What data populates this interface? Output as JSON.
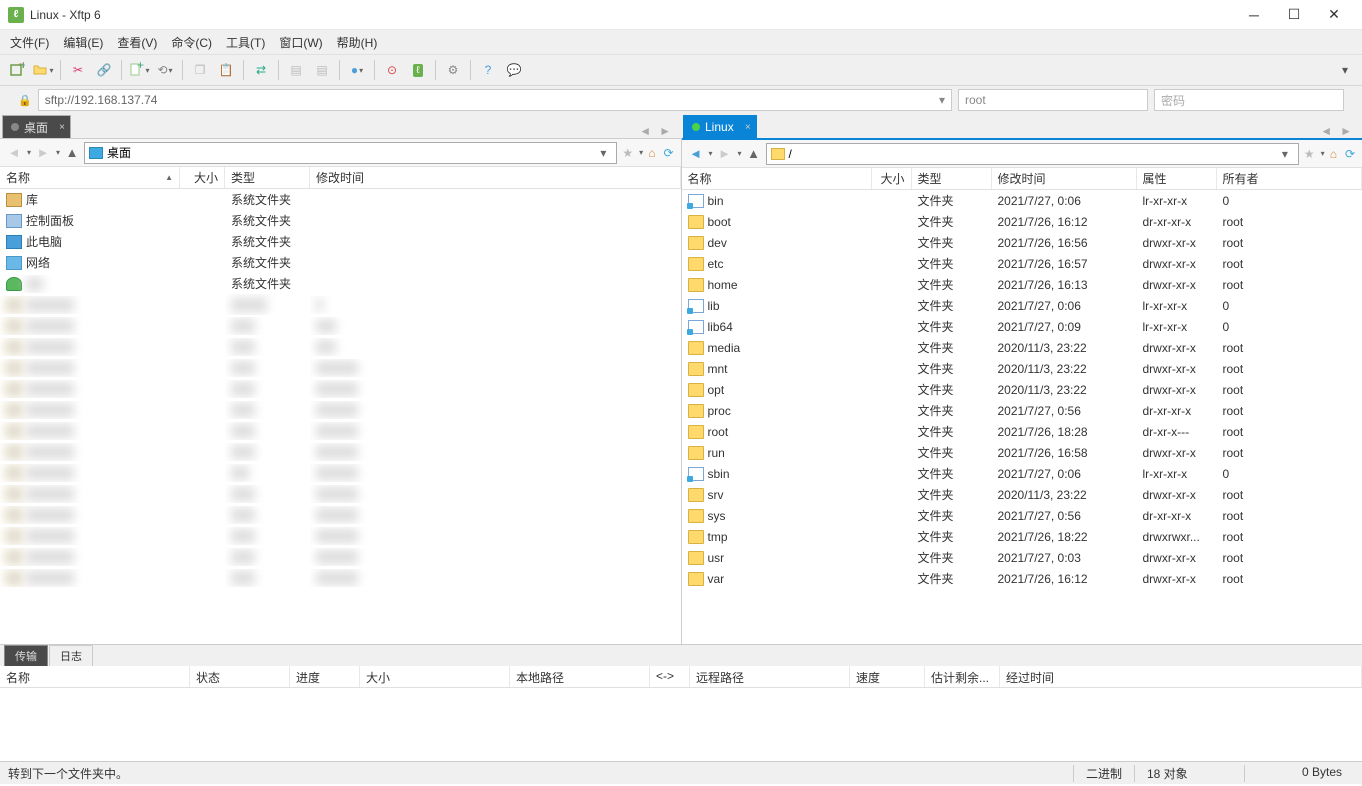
{
  "window": {
    "title": "Linux - Xftp 6",
    "app_badge": "ℓ"
  },
  "menu": {
    "file": "文件(F)",
    "edit": "编辑(E)",
    "view": "查看(V)",
    "cmd": "命令(C)",
    "tool": "工具(T)",
    "win": "窗口(W)",
    "help": "帮助(H)"
  },
  "address": {
    "url": "sftp://192.168.137.74",
    "user": "root",
    "pass_placeholder": "密码"
  },
  "tabs": {
    "local": "桌面",
    "remote": "Linux"
  },
  "local": {
    "path": "桌面",
    "columns": {
      "name": "名称",
      "size": "大小",
      "type": "类型",
      "modified": "修改时间"
    },
    "items": [
      {
        "name": "库",
        "type": "系统文件夹",
        "icon": "lib"
      },
      {
        "name": "控制面板",
        "type": "系统文件夹",
        "icon": "cpanel"
      },
      {
        "name": "此电脑",
        "type": "系统文件夹",
        "icon": "pc"
      },
      {
        "name": "网络",
        "type": "系统文件夹",
        "icon": "net"
      },
      {
        "name": "",
        "type": "系统文件夹",
        "icon": "user",
        "blur": true
      }
    ]
  },
  "remote": {
    "path": "/",
    "columns": {
      "name": "名称",
      "size": "大小",
      "type": "类型",
      "modified": "修改时间",
      "attr": "属性",
      "owner": "所有者"
    },
    "items": [
      {
        "name": "bin",
        "type": "文件夹",
        "modified": "2021/7/27, 0:06",
        "attr": "lr-xr-xr-x",
        "owner": "0",
        "link": true
      },
      {
        "name": "boot",
        "type": "文件夹",
        "modified": "2021/7/26, 16:12",
        "attr": "dr-xr-xr-x",
        "owner": "root"
      },
      {
        "name": "dev",
        "type": "文件夹",
        "modified": "2021/7/26, 16:56",
        "attr": "drwxr-xr-x",
        "owner": "root"
      },
      {
        "name": "etc",
        "type": "文件夹",
        "modified": "2021/7/26, 16:57",
        "attr": "drwxr-xr-x",
        "owner": "root"
      },
      {
        "name": "home",
        "type": "文件夹",
        "modified": "2021/7/26, 16:13",
        "attr": "drwxr-xr-x",
        "owner": "root"
      },
      {
        "name": "lib",
        "type": "文件夹",
        "modified": "2021/7/27, 0:06",
        "attr": "lr-xr-xr-x",
        "owner": "0",
        "link": true
      },
      {
        "name": "lib64",
        "type": "文件夹",
        "modified": "2021/7/27, 0:09",
        "attr": "lr-xr-xr-x",
        "owner": "0",
        "link": true
      },
      {
        "name": "media",
        "type": "文件夹",
        "modified": "2020/11/3, 23:22",
        "attr": "drwxr-xr-x",
        "owner": "root"
      },
      {
        "name": "mnt",
        "type": "文件夹",
        "modified": "2020/11/3, 23:22",
        "attr": "drwxr-xr-x",
        "owner": "root"
      },
      {
        "name": "opt",
        "type": "文件夹",
        "modified": "2020/11/3, 23:22",
        "attr": "drwxr-xr-x",
        "owner": "root"
      },
      {
        "name": "proc",
        "type": "文件夹",
        "modified": "2021/7/27, 0:56",
        "attr": "dr-xr-xr-x",
        "owner": "root"
      },
      {
        "name": "root",
        "type": "文件夹",
        "modified": "2021/7/26, 18:28",
        "attr": "dr-xr-x---",
        "owner": "root"
      },
      {
        "name": "run",
        "type": "文件夹",
        "modified": "2021/7/26, 16:58",
        "attr": "drwxr-xr-x",
        "owner": "root"
      },
      {
        "name": "sbin",
        "type": "文件夹",
        "modified": "2021/7/27, 0:06",
        "attr": "lr-xr-xr-x",
        "owner": "0",
        "link": true
      },
      {
        "name": "srv",
        "type": "文件夹",
        "modified": "2020/11/3, 23:22",
        "attr": "drwxr-xr-x",
        "owner": "root"
      },
      {
        "name": "sys",
        "type": "文件夹",
        "modified": "2021/7/27, 0:56",
        "attr": "dr-xr-xr-x",
        "owner": "root"
      },
      {
        "name": "tmp",
        "type": "文件夹",
        "modified": "2021/7/26, 18:22",
        "attr": "drwxrwxr...",
        "owner": "root"
      },
      {
        "name": "usr",
        "type": "文件夹",
        "modified": "2021/7/27, 0:03",
        "attr": "drwxr-xr-x",
        "owner": "root"
      },
      {
        "name": "var",
        "type": "文件夹",
        "modified": "2021/7/26, 16:12",
        "attr": "drwxr-xr-x",
        "owner": "root"
      }
    ]
  },
  "bottom_tabs": {
    "transfer": "传输",
    "log": "日志"
  },
  "transfer_cols": {
    "name": "名称",
    "status": "状态",
    "progress": "进度",
    "size": "大小",
    "local": "本地路径",
    "dir": "<->",
    "remote": "远程路径",
    "speed": "速度",
    "eta": "估计剩余...",
    "elapsed": "经过时间"
  },
  "status": {
    "msg": "转到下一个文件夹中。",
    "mode": "二进制",
    "objects": "18 对象",
    "bytes": "0 Bytes"
  },
  "blur_rows": [
    {
      "type": "文件夹",
      "mod": "2"
    },
    {
      "type": "",
      "mod": "202"
    },
    {
      "type": "",
      "mod": "202"
    },
    {
      "type": "",
      "mod": ""
    },
    {
      "type": "",
      "mod": ""
    },
    {
      "type": "",
      "mod": ""
    },
    {
      "type": "",
      "mod": ""
    },
    {
      "type": "",
      "mod": ""
    },
    {
      "type": "re -",
      "mod": ""
    },
    {
      "type": "",
      "mod": ""
    },
    {
      "type": "",
      "mod": ""
    },
    {
      "type": "",
      "mod": ""
    },
    {
      "type": "",
      "mod": ""
    },
    {
      "type": "",
      "mod": ""
    }
  ]
}
